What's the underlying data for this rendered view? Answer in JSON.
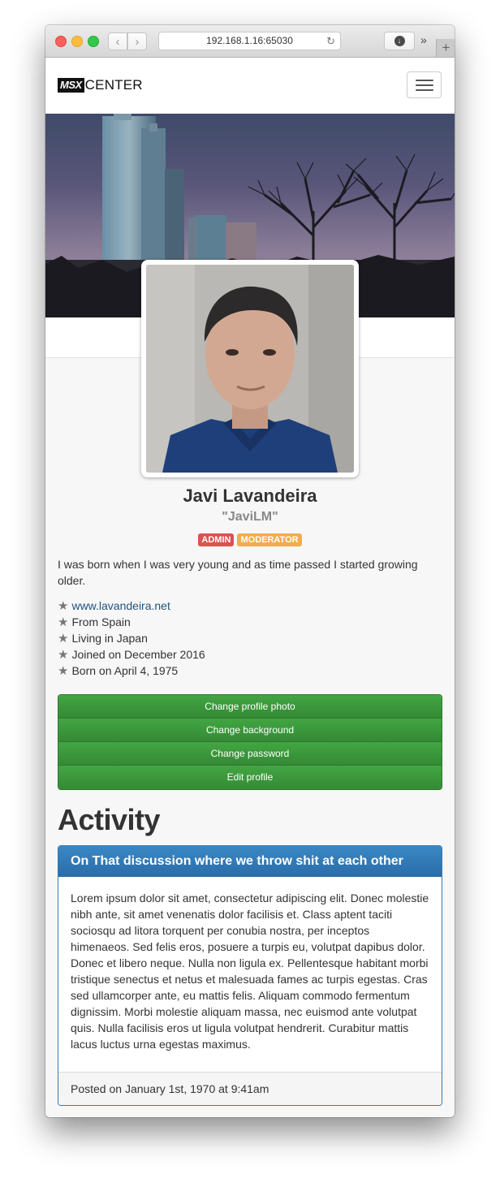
{
  "browser": {
    "url": "192.168.1.16:65030",
    "back_glyph": "‹",
    "forward_glyph": "›",
    "reload_glyph": "↻",
    "download_glyph": "↓",
    "overflow_glyph": "»",
    "newtab_glyph": "+"
  },
  "navbar": {
    "logo_badge": "MSX",
    "logo_text": "CENTER"
  },
  "profile": {
    "name": "Javi Lavandeira",
    "nickname": "\"JaviLM\"",
    "badges": [
      "ADMIN",
      "MODERATOR"
    ],
    "bio": "I was born when I was very young and as time passed I started growing older.",
    "facts": [
      "www.lavandeira.net",
      "From Spain",
      "Living in Japan",
      "Joined on December 2016",
      "Born on April 4, 1975"
    ],
    "fact_star": "★"
  },
  "actions": {
    "change_photo": "Change profile photo",
    "change_background": "Change background",
    "change_password": "Change password",
    "edit_profile": "Edit profile"
  },
  "activity": {
    "heading": "Activity",
    "post_title": "On That discussion where we throw shit at each other",
    "post_body": "Lorem ipsum dolor sit amet, consectetur adipiscing elit. Donec molestie nibh ante, sit amet venenatis dolor facilisis et. Class aptent taciti sociosqu ad litora torquent per conubia nostra, per inceptos himenaeos. Sed felis eros, posuere a turpis eu, volutpat dapibus dolor. Donec et libero neque. Nulla non ligula ex. Pellentesque habitant morbi tristique senectus et netus et malesuada fames ac turpis egestas. Cras sed ullamcorper ante, eu mattis felis. Aliquam commodo fermentum dignissim. Morbi molestie aliquam massa, nec euismod ante volutpat quis. Nulla facilisis eros ut ligula volutpat hendrerit. Curabitur mattis lacus luctus urna egestas maximus.",
    "post_footer": "Posted on January 1st, 1970 at 9:41am"
  },
  "colors": {
    "admin_badge": "#d9534f",
    "moderator_badge": "#f0ad4e",
    "action_button": "#3d9a3d",
    "panel_primary": "#337ab7",
    "link": "#23527c"
  }
}
